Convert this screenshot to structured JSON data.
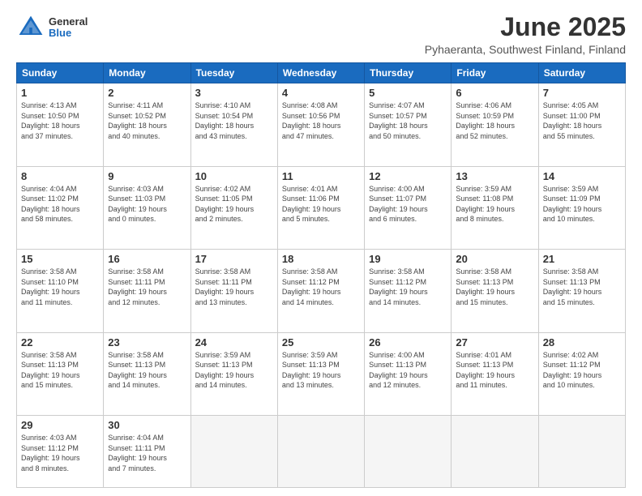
{
  "header": {
    "logo_general": "General",
    "logo_blue": "Blue",
    "main_title": "June 2025",
    "sub_title": "Pyhaeranta, Southwest Finland, Finland"
  },
  "columns": [
    "Sunday",
    "Monday",
    "Tuesday",
    "Wednesday",
    "Thursday",
    "Friday",
    "Saturday"
  ],
  "weeks": [
    [
      {
        "day": "1",
        "info": "Sunrise: 4:13 AM\nSunset: 10:50 PM\nDaylight: 18 hours\nand 37 minutes."
      },
      {
        "day": "2",
        "info": "Sunrise: 4:11 AM\nSunset: 10:52 PM\nDaylight: 18 hours\nand 40 minutes."
      },
      {
        "day": "3",
        "info": "Sunrise: 4:10 AM\nSunset: 10:54 PM\nDaylight: 18 hours\nand 43 minutes."
      },
      {
        "day": "4",
        "info": "Sunrise: 4:08 AM\nSunset: 10:56 PM\nDaylight: 18 hours\nand 47 minutes."
      },
      {
        "day": "5",
        "info": "Sunrise: 4:07 AM\nSunset: 10:57 PM\nDaylight: 18 hours\nand 50 minutes."
      },
      {
        "day": "6",
        "info": "Sunrise: 4:06 AM\nSunset: 10:59 PM\nDaylight: 18 hours\nand 52 minutes."
      },
      {
        "day": "7",
        "info": "Sunrise: 4:05 AM\nSunset: 11:00 PM\nDaylight: 18 hours\nand 55 minutes."
      }
    ],
    [
      {
        "day": "8",
        "info": "Sunrise: 4:04 AM\nSunset: 11:02 PM\nDaylight: 18 hours\nand 58 minutes."
      },
      {
        "day": "9",
        "info": "Sunrise: 4:03 AM\nSunset: 11:03 PM\nDaylight: 19 hours\nand 0 minutes."
      },
      {
        "day": "10",
        "info": "Sunrise: 4:02 AM\nSunset: 11:05 PM\nDaylight: 19 hours\nand 2 minutes."
      },
      {
        "day": "11",
        "info": "Sunrise: 4:01 AM\nSunset: 11:06 PM\nDaylight: 19 hours\nand 5 minutes."
      },
      {
        "day": "12",
        "info": "Sunrise: 4:00 AM\nSunset: 11:07 PM\nDaylight: 19 hours\nand 6 minutes."
      },
      {
        "day": "13",
        "info": "Sunrise: 3:59 AM\nSunset: 11:08 PM\nDaylight: 19 hours\nand 8 minutes."
      },
      {
        "day": "14",
        "info": "Sunrise: 3:59 AM\nSunset: 11:09 PM\nDaylight: 19 hours\nand 10 minutes."
      }
    ],
    [
      {
        "day": "15",
        "info": "Sunrise: 3:58 AM\nSunset: 11:10 PM\nDaylight: 19 hours\nand 11 minutes."
      },
      {
        "day": "16",
        "info": "Sunrise: 3:58 AM\nSunset: 11:11 PM\nDaylight: 19 hours\nand 12 minutes."
      },
      {
        "day": "17",
        "info": "Sunrise: 3:58 AM\nSunset: 11:11 PM\nDaylight: 19 hours\nand 13 minutes."
      },
      {
        "day": "18",
        "info": "Sunrise: 3:58 AM\nSunset: 11:12 PM\nDaylight: 19 hours\nand 14 minutes."
      },
      {
        "day": "19",
        "info": "Sunrise: 3:58 AM\nSunset: 11:12 PM\nDaylight: 19 hours\nand 14 minutes."
      },
      {
        "day": "20",
        "info": "Sunrise: 3:58 AM\nSunset: 11:13 PM\nDaylight: 19 hours\nand 15 minutes."
      },
      {
        "day": "21",
        "info": "Sunrise: 3:58 AM\nSunset: 11:13 PM\nDaylight: 19 hours\nand 15 minutes."
      }
    ],
    [
      {
        "day": "22",
        "info": "Sunrise: 3:58 AM\nSunset: 11:13 PM\nDaylight: 19 hours\nand 15 minutes."
      },
      {
        "day": "23",
        "info": "Sunrise: 3:58 AM\nSunset: 11:13 PM\nDaylight: 19 hours\nand 14 minutes."
      },
      {
        "day": "24",
        "info": "Sunrise: 3:59 AM\nSunset: 11:13 PM\nDaylight: 19 hours\nand 14 minutes."
      },
      {
        "day": "25",
        "info": "Sunrise: 3:59 AM\nSunset: 11:13 PM\nDaylight: 19 hours\nand 13 minutes."
      },
      {
        "day": "26",
        "info": "Sunrise: 4:00 AM\nSunset: 11:13 PM\nDaylight: 19 hours\nand 12 minutes."
      },
      {
        "day": "27",
        "info": "Sunrise: 4:01 AM\nSunset: 11:13 PM\nDaylight: 19 hours\nand 11 minutes."
      },
      {
        "day": "28",
        "info": "Sunrise: 4:02 AM\nSunset: 11:12 PM\nDaylight: 19 hours\nand 10 minutes."
      }
    ],
    [
      {
        "day": "29",
        "info": "Sunrise: 4:03 AM\nSunset: 11:12 PM\nDaylight: 19 hours\nand 8 minutes."
      },
      {
        "day": "30",
        "info": "Sunrise: 4:04 AM\nSunset: 11:11 PM\nDaylight: 19 hours\nand 7 minutes."
      },
      {
        "day": "",
        "info": ""
      },
      {
        "day": "",
        "info": ""
      },
      {
        "day": "",
        "info": ""
      },
      {
        "day": "",
        "info": ""
      },
      {
        "day": "",
        "info": ""
      }
    ]
  ]
}
